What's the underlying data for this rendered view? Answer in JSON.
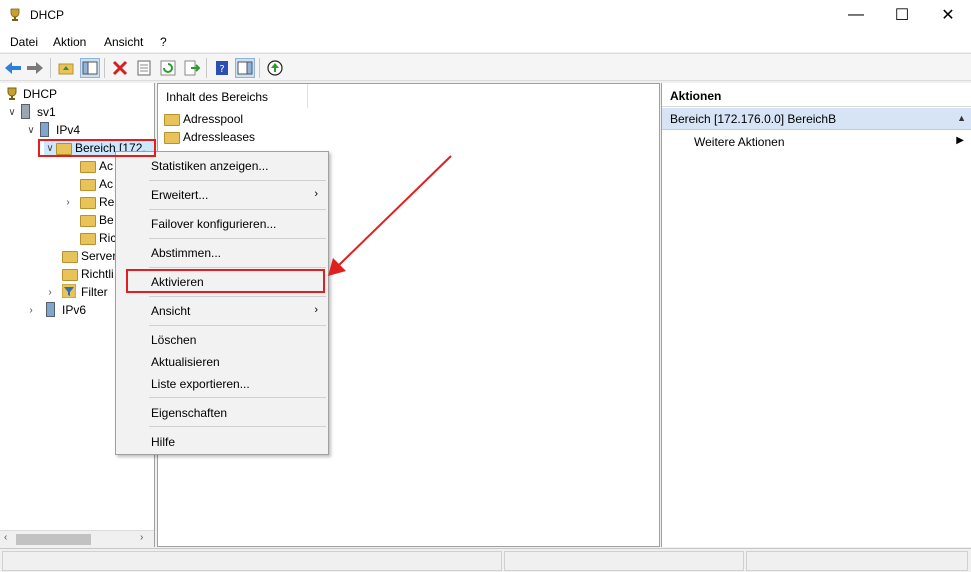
{
  "window": {
    "title": "DHCP"
  },
  "window_controls": {
    "minimize": "—",
    "maximize": "☐",
    "close": "✕"
  },
  "menu": [
    "Datei",
    "Aktion",
    "Ansicht",
    "?"
  ],
  "toolbar": [
    "back-arrow-icon",
    "forward-arrow-icon",
    "up-folder-icon",
    "show-hide-tree-icon",
    "delete-icon",
    "properties-icon",
    "refresh-icon",
    "export-icon",
    "help-icon",
    "action-pane-icon",
    "activate-icon"
  ],
  "tree": {
    "root": "DHCP",
    "server": "sv1",
    "ipv4": "IPv4",
    "scope": "Bereich [172.",
    "scope_children": [
      "Ac",
      "Ac",
      "Re",
      "Be",
      "Ric"
    ],
    "server_options": "Server",
    "policies": "Richtli",
    "filter": "Filter",
    "ipv6": "IPv6"
  },
  "content": {
    "column_header": "Inhalt des Bereichs",
    "items": [
      "Adresspool",
      "Adressleases"
    ]
  },
  "actions": {
    "header": "Aktionen",
    "section": "Bereich [172.176.0.0] BereichB",
    "more": "Weitere Aktionen"
  },
  "context_menu": {
    "items": [
      "Statistiken anzeigen...",
      "Erweitert...",
      "Failover konfigurieren...",
      "Abstimmen...",
      "Aktivieren",
      "Ansicht",
      "Löschen",
      "Aktualisieren",
      "Liste exportieren...",
      "Eigenschaften",
      "Hilfe"
    ],
    "highlighted": "Aktivieren"
  },
  "colors": {
    "highlight_red": "#e02020",
    "selection": "#cce8ff",
    "actions_section": "#d6e4f5"
  }
}
